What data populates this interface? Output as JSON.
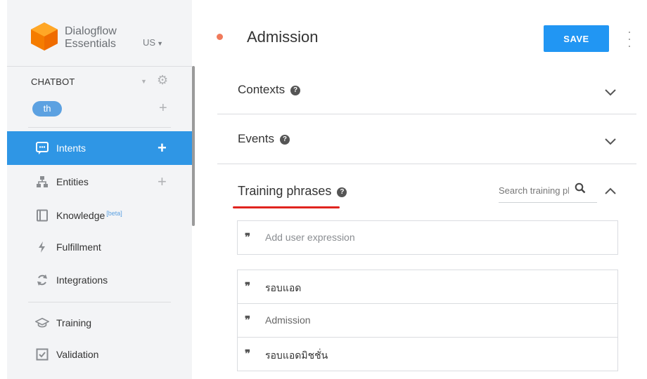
{
  "brand": {
    "name_line1": "Dialogflow",
    "name_line2": "Essentials",
    "region": "US",
    "logo_color": "#f57c00"
  },
  "agent": {
    "name": "CHATBOT",
    "language_chip": "th"
  },
  "nav": {
    "items": [
      {
        "label": "Intents",
        "icon": "intents-icon",
        "active": true,
        "has_add": true
      },
      {
        "label": "Entities",
        "icon": "entities-icon",
        "active": false,
        "has_add": true
      },
      {
        "label": "Knowledge",
        "badge": "[beta]",
        "icon": "knowledge-icon",
        "active": false,
        "has_add": false
      },
      {
        "label": "Fulfillment",
        "icon": "fulfillment-icon",
        "active": false,
        "has_add": false
      },
      {
        "label": "Integrations",
        "icon": "integrations-icon",
        "active": false,
        "has_add": false
      },
      {
        "label": "Training",
        "icon": "training-icon",
        "active": false,
        "has_add": false
      },
      {
        "label": "Validation",
        "icon": "validation-icon",
        "active": false,
        "has_add": false
      }
    ],
    "active_color": "#2f96e5"
  },
  "header": {
    "intent_title": "Admission",
    "save_label": "SAVE",
    "status_dot_color": "#f07a5b"
  },
  "sections": {
    "contexts": {
      "label": "Contexts",
      "expanded": false
    },
    "events": {
      "label": "Events",
      "expanded": false
    },
    "training": {
      "label": "Training phrases",
      "expanded": true,
      "search_placeholder": "Search training phrases",
      "add_placeholder": "Add user expression",
      "phrases": [
        "รอบแอด",
        "Admission",
        "รอบแอดมิชชั่น"
      ]
    }
  },
  "colors": {
    "accent": "#2196f3",
    "underline": "#e0241f"
  }
}
